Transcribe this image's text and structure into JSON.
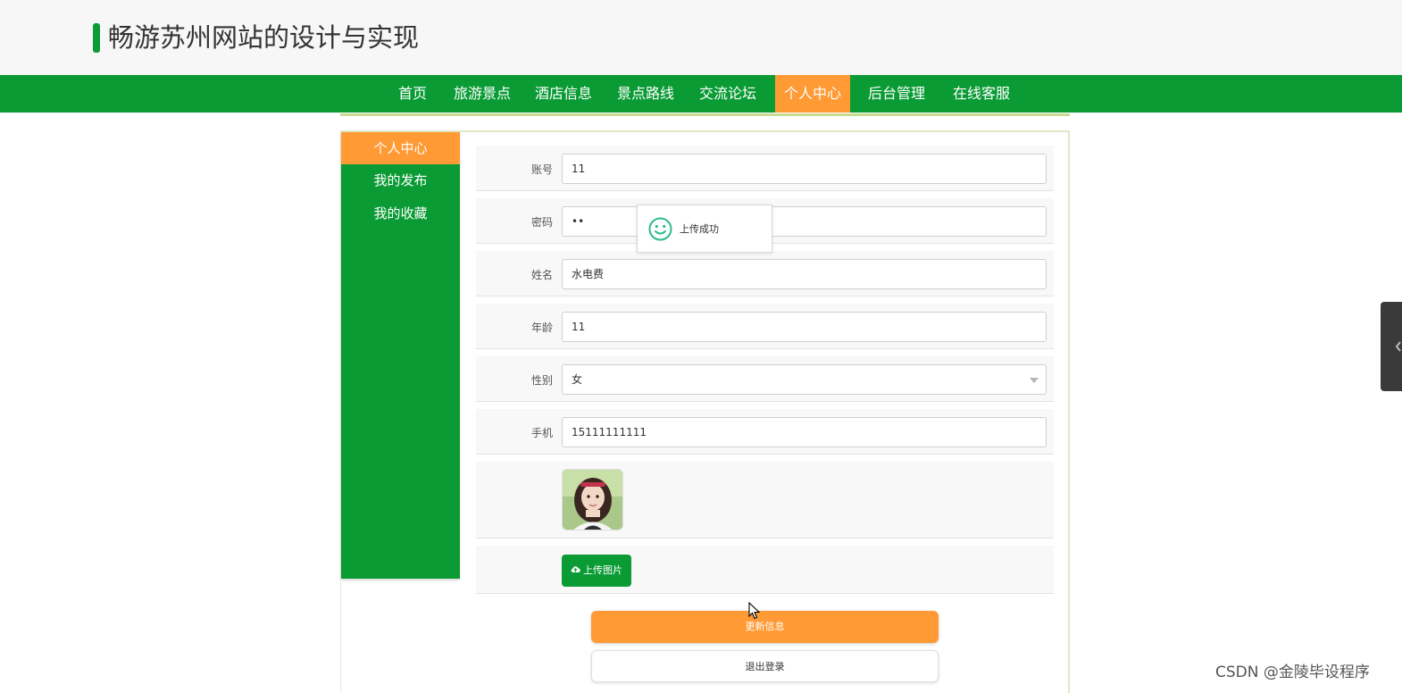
{
  "site": {
    "title": "畅游苏州网站的设计与实现"
  },
  "nav": {
    "items": [
      "首页",
      "旅游景点",
      "酒店信息",
      "景点路线",
      "交流论坛",
      "个人中心",
      "后台管理",
      "在线客服"
    ],
    "active": "个人中心"
  },
  "sidebar": {
    "items": [
      "个人中心",
      "我的发布",
      "我的收藏"
    ],
    "active": "个人中心"
  },
  "form": {
    "account_label": "账号",
    "account_value": "11",
    "password_label": "密码",
    "password_value": "••",
    "name_label": "姓名",
    "name_value": "水电费",
    "age_label": "年龄",
    "age_value": "11",
    "gender_label": "性别",
    "gender_value": "女",
    "phone_label": "手机",
    "phone_value": "15111111111",
    "upload_label": "上传图片",
    "update_button": "更新信息",
    "logout_button": "退出登录"
  },
  "toast": {
    "message": "上传成功"
  },
  "watermark": "CSDN @金陵毕设程序",
  "colors": {
    "primary_green": "#0a9b35",
    "accent_orange": "#ff9a35"
  },
  "icons": {
    "toast": "smiley-icon",
    "upload": "cloud-upload-icon"
  }
}
